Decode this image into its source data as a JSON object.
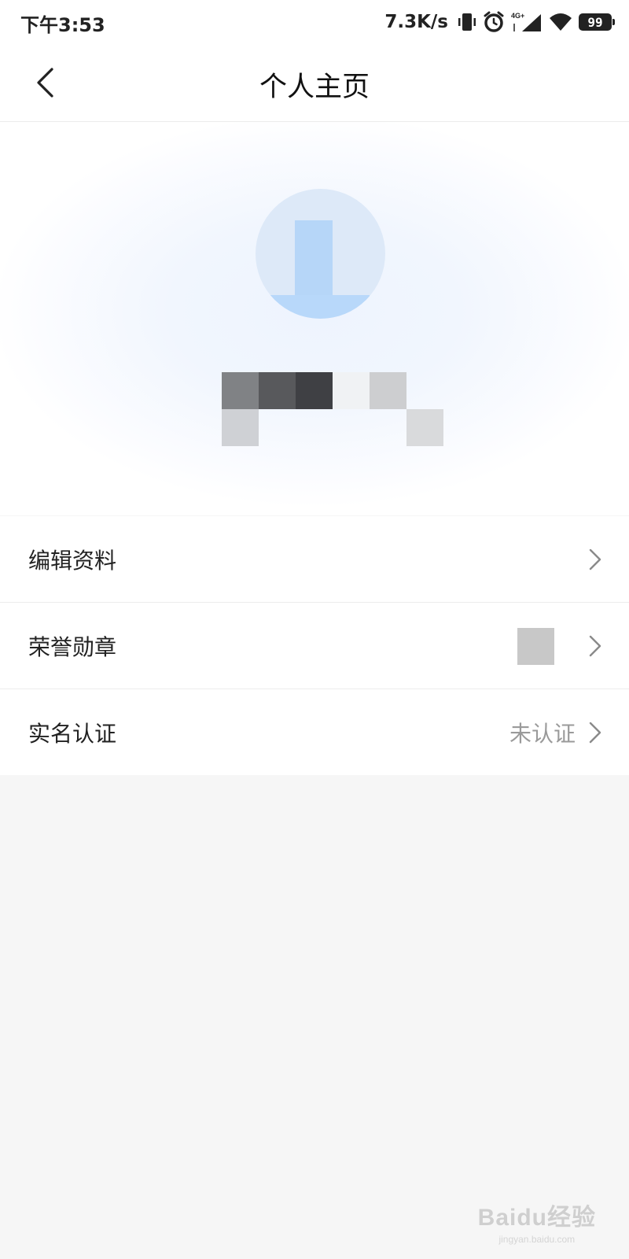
{
  "status_bar": {
    "time": "下午3:53",
    "network_speed": "7.3K/s",
    "icons": [
      "vibrate-icon",
      "alarm-icon",
      "4g-signal-icon",
      "wifi-icon",
      "battery-icon"
    ],
    "network_type": "4G+",
    "battery_level": "99"
  },
  "nav": {
    "title": "个人主页",
    "back_icon": "chevron-left-icon"
  },
  "profile": {
    "avatar_colors": [
      "#dde9f8",
      "#b6d6f8"
    ],
    "nickname_blur_colors": [
      "#808285",
      "#58595c",
      "#3f4044",
      "#f0f2f4",
      "#cdced0",
      "#cfd1d5",
      "#d9dadc"
    ]
  },
  "menu": {
    "items": [
      {
        "label": "编辑资料",
        "value": ""
      },
      {
        "label": "荣誉勋章",
        "value": ""
      },
      {
        "label": "实名认证",
        "value": "未认证"
      }
    ],
    "chevron_icon": "chevron-right-icon"
  },
  "watermark": {
    "logo": "Baidu经验",
    "url": "jingyan.baidu.com"
  }
}
